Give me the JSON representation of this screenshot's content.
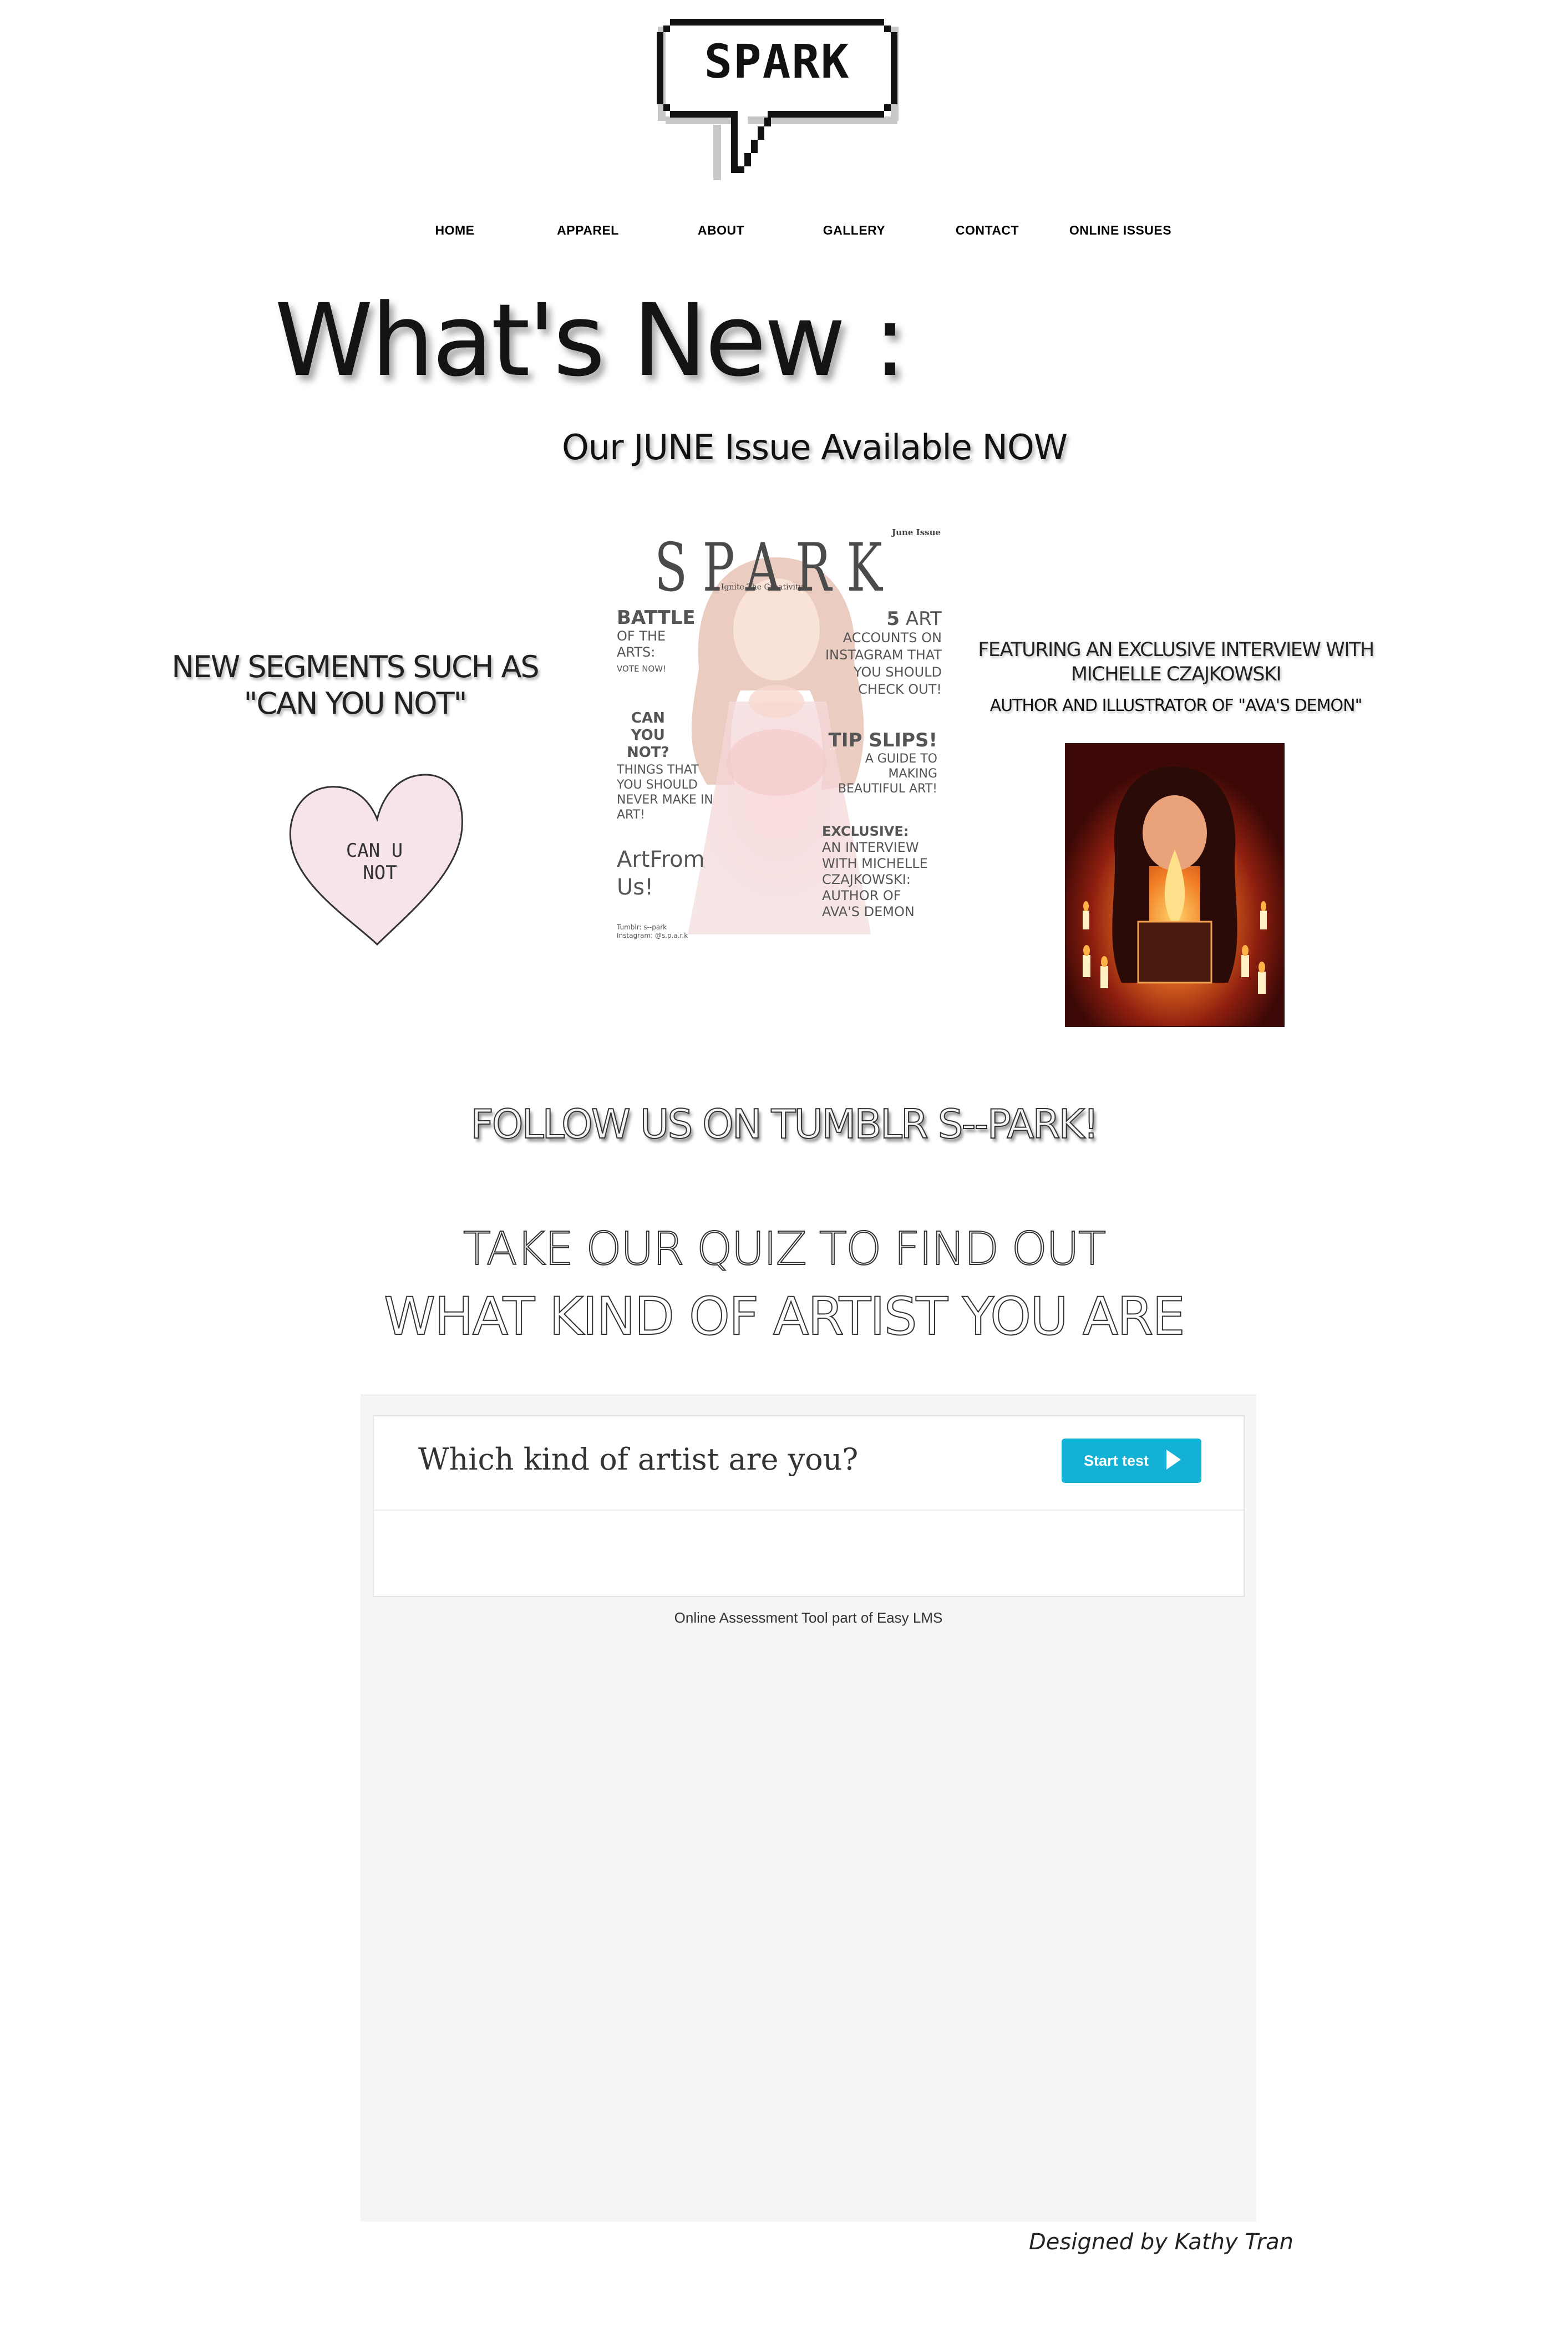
{
  "logo": {
    "text": "SPARK",
    "icon": "speech-bubble-logo"
  },
  "nav": {
    "items": [
      {
        "label": "HOME"
      },
      {
        "label": "APPAREL"
      },
      {
        "label": "ABOUT"
      },
      {
        "label": "GALLERY"
      },
      {
        "label": "CONTACT"
      },
      {
        "label": "ONLINE ISSUES"
      }
    ]
  },
  "hero": {
    "title": "What's New :",
    "subtitle": "Our JUNE Issue Available NOW"
  },
  "segments": {
    "text_line1": "NEW SEGMENTS SUCH AS",
    "text_line2": "\"CAN YOU NOT\"",
    "heart_line1": "CAN U",
    "heart_line2": "NOT",
    "heart_color": "#f6e3ec"
  },
  "cover": {
    "title": "SPARK",
    "issue": "June Issue",
    "tagline": "Ignite The Creativity",
    "battle_head": "BATTLE",
    "battle_l1": "OF THE",
    "battle_l2": "ARTS:",
    "battle_vote": "VOTE NOW!",
    "cyn_l1": "CAN",
    "cyn_l2": "YOU",
    "cyn_l3": "NOT?",
    "things_l1": "THINGS THAT",
    "things_l2": "YOU SHOULD",
    "things_l3": "NEVER MAKE IN",
    "things_l4": "ART!",
    "art_from": "ArtFrom",
    "us": "Us!",
    "socials_l1": "Tumblr: s--park",
    "socials_l2": "Instagram: @s.p.a.r.k",
    "five_art_num": "5",
    "five_art_word": "ART",
    "accounts_l1": "ACCOUNTS ON",
    "accounts_l2": "INSTAGRAM THAT",
    "accounts_l3": "YOU SHOULD",
    "accounts_l4": "CHECK OUT!",
    "tip_slips": "TIP SLIPS!",
    "guide_l1": "A GUIDE TO",
    "guide_l2": "MAKING",
    "guide_l3": "BEAUTIFUL ART!",
    "exclusive": "EXCLUSIVE:",
    "interview_l1": "AN INTERVIEW",
    "interview_l2": "WITH MICHELLE",
    "interview_l3": "CZAJKOWSKI:",
    "interview_l4": "AUTHOR OF",
    "interview_l5": "AVA'S DEMON"
  },
  "featuring": {
    "line1": "FEATURING AN EXCLUSIVE INTERVIEW WITH",
    "line2": "MICHELLE CZAJKOWSKI",
    "author": "AUTHOR AND ILLUSTRATOR OF \"AVA'S DEMON\""
  },
  "follow": {
    "text": "FOLLOW US ON TUMBLR S--PARK!"
  },
  "quiz_heading": {
    "line1": "TAKE OUR QUIZ TO FIND OUT",
    "line2": "WHAT KIND OF ARTIST YOU ARE"
  },
  "quiz_widget": {
    "question": "Which kind of artist are you?",
    "start_label": "Start test",
    "start_icon": "play-icon",
    "button_color": "#14b1d6",
    "powered_by": "Online Assessment Tool part of Easy LMS"
  },
  "footer": {
    "designed_by": "Designed by Kathy Tran"
  }
}
